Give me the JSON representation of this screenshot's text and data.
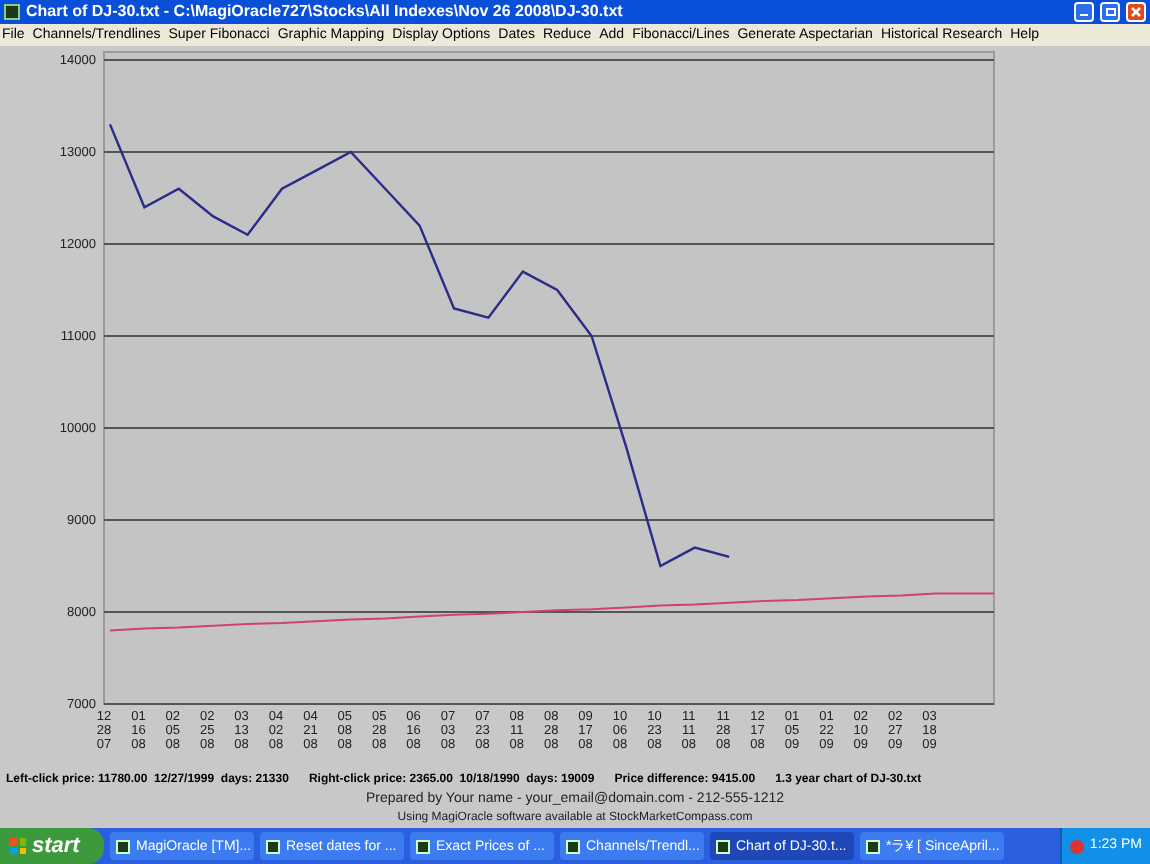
{
  "window": {
    "title": "Chart of DJ-30.txt - C:\\MagiOracle727\\Stocks\\All Indexes\\Nov 26 2008\\DJ-30.txt"
  },
  "menu": [
    "File",
    "Channels/Trendlines",
    "Super Fibonacci",
    "Graphic Mapping",
    "Display Options",
    "Dates",
    "Reduce",
    "Add",
    "Fibonacci/Lines",
    "Generate Aspectarian",
    "Historical Research",
    "Help"
  ],
  "chart": {
    "chart_data": {
      "type": "line",
      "categories": [
        "12\n28\n07",
        "01\n16\n08",
        "02\n05\n08",
        "02\n25\n08",
        "03\n13\n08",
        "04\n02\n08",
        "04\n21\n08",
        "05\n08\n08",
        "05\n28\n08",
        "06\n16\n08",
        "07\n03\n08",
        "07\n23\n08",
        "08\n11\n08",
        "08\n28\n08",
        "09\n17\n08",
        "10\n06\n08",
        "10\n23\n08",
        "11\n11\n08",
        "11\n28\n08",
        "12\n17\n08",
        "01\n05\n09",
        "01\n22\n09",
        "02\n10\n09",
        "02\n27\n09",
        "03\n18\n09"
      ],
      "series": [
        {
          "color": "#2b2b8a",
          "values": [
            13300,
            12400,
            12600,
            12300,
            12100,
            12600,
            12800,
            13000,
            12600,
            12200,
            11300,
            11200,
            11700,
            11500,
            11000,
            9800,
            8500,
            8700,
            8600,
            null,
            null,
            null,
            null,
            null,
            null
          ]
        },
        {
          "color": "#d04070",
          "values": [
            7800,
            7820,
            7830,
            7850,
            7870,
            7880,
            7900,
            7920,
            7930,
            7950,
            7970,
            7980,
            8000,
            8020,
            8030,
            8050,
            8070,
            8080,
            8100,
            8120,
            8130,
            8150,
            8170,
            8180,
            8200
          ]
        }
      ],
      "grid": true,
      "ylim": [
        7000,
        14000
      ],
      "yticks": [
        7000,
        8000,
        9000,
        10000,
        11000,
        12000,
        13000,
        14000
      ]
    }
  },
  "info": {
    "left_click": "Left-click price: 11780.00  12/27/1999  days: 21330",
    "right_click": "Right-click price: 2365.00  10/18/1990  days: 19009",
    "difference": "Price difference: 9415.00",
    "description": "1.3 year chart of DJ-30.txt"
  },
  "prepared_by": "Prepared by Your name - your_email@domain.com - 212-555-1212",
  "using": "Using MagiOracle software available at StockMarketCompass.com",
  "taskbar": {
    "start": "start",
    "items": [
      {
        "label": "MagiOracle [TM]...",
        "selected": false
      },
      {
        "label": "Reset dates for ...",
        "selected": false
      },
      {
        "label": "Exact Prices of ...",
        "selected": false
      },
      {
        "label": "Channels/Trendl...",
        "selected": false
      },
      {
        "label": "Chart of DJ-30.t...",
        "selected": true
      },
      {
        "label": "*ラ¥ [ SinceApril...",
        "selected": false
      }
    ],
    "clock": "1:23 PM"
  }
}
